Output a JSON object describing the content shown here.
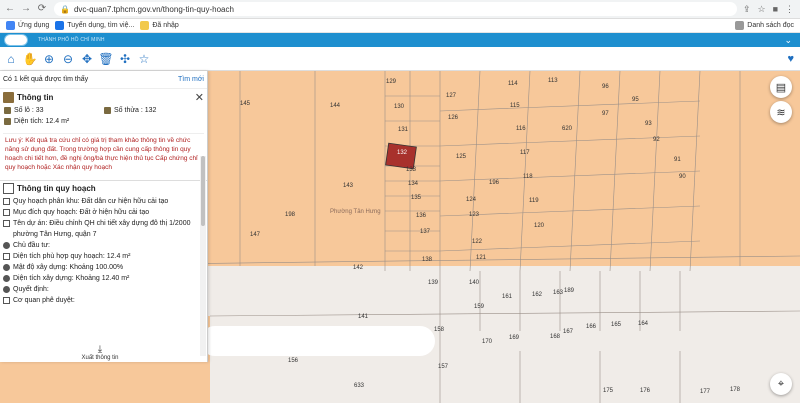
{
  "browser": {
    "url": "dvc-quan7.tphcm.gov.vn/thong-tin-quy-hoach",
    "bookmarks": [
      "Ứng dụng",
      "Tuyển dụng, tìm việ...",
      "Đã nhập"
    ],
    "reading_list": "Danh sách đọc"
  },
  "app": {
    "title": "THÀNH PHỐ HỒ CHÍ MINH"
  },
  "panel": {
    "result_text": "Có 1 kết quả được tìm thấy",
    "new_search": "Tìm mới",
    "info_title": "Thông tin",
    "lot_no": "Số lô : 33",
    "parcel_no": "Số thửa : 132",
    "area": "Diện tích: 12.4 m²",
    "warning": "Lưu ý: Kết quả tra cứu chỉ có giá trị tham khảo thông tin về chức năng sử dụng đất. Trong trường hợp cần cung cấp thông tin quy hoạch chi tiết hơn, đề nghị ông/bà thực hiện thủ tục Cấp chứng chỉ quy hoạch hoặc Xác nhận quy hoạch",
    "plan_title": "Thông tin quy hoạch",
    "plan_rows": [
      "Quy hoạch phân khu: Đất dân cư hiện hữu cải tạo",
      "Mục đích quy hoạch: Đất ở hiện hữu cải tạo",
      "Tên dự án: Điều chỉnh QH chi tiết xây dựng đô thị 1/2000",
      "phường Tân Hưng, quận 7",
      "Chủ đầu tư:",
      "Diện tích phù hợp quy hoạch: 12.4 m²",
      "Mật độ xây dựng: Khoảng 100.00%",
      "Diện tích xây dựng: Khoảng 12.40 m²",
      "Quyết định:",
      "Cơ quan phê duyệt:"
    ],
    "export_label": "Xuất thông tin"
  },
  "map": {
    "ward_label": "Phường Tân Hưng",
    "highlight_color": "#a8312c",
    "parcel_color": "#f7c89a",
    "lots": [
      {
        "t": "145"
      },
      {
        "t": "144"
      },
      {
        "t": "129"
      },
      {
        "t": "130"
      },
      {
        "t": "127"
      },
      {
        "t": "126"
      },
      {
        "t": "131"
      },
      {
        "t": "132"
      },
      {
        "t": "133"
      },
      {
        "t": "134"
      },
      {
        "t": "135"
      },
      {
        "t": "136"
      },
      {
        "t": "137"
      },
      {
        "t": "138"
      },
      {
        "t": "143"
      },
      {
        "t": "198"
      },
      {
        "t": "147"
      },
      {
        "t": "142"
      },
      {
        "t": "125"
      },
      {
        "t": "124"
      },
      {
        "t": "123"
      },
      {
        "t": "122"
      },
      {
        "t": "121"
      },
      {
        "t": "114"
      },
      {
        "t": "113"
      },
      {
        "t": "115"
      },
      {
        "t": "116"
      },
      {
        "t": "117"
      },
      {
        "t": "118"
      },
      {
        "t": "119"
      },
      {
        "t": "120"
      },
      {
        "t": "96"
      },
      {
        "t": "95"
      },
      {
        "t": "97"
      },
      {
        "t": "93"
      },
      {
        "t": "92"
      },
      {
        "t": "91"
      },
      {
        "t": "90"
      },
      {
        "t": "620"
      },
      {
        "t": "196"
      },
      {
        "t": "139"
      },
      {
        "t": "140"
      },
      {
        "t": "159"
      },
      {
        "t": "161"
      },
      {
        "t": "162"
      },
      {
        "t": "163"
      },
      {
        "t": "189"
      },
      {
        "t": "141"
      },
      {
        "t": "158"
      },
      {
        "t": "170"
      },
      {
        "t": "169"
      },
      {
        "t": "168"
      },
      {
        "t": "167"
      },
      {
        "t": "166"
      },
      {
        "t": "165"
      },
      {
        "t": "164"
      },
      {
        "t": "156"
      },
      {
        "t": "157"
      },
      {
        "t": "633"
      },
      {
        "t": "178"
      },
      {
        "t": "177"
      },
      {
        "t": "176"
      },
      {
        "t": "175"
      }
    ]
  }
}
